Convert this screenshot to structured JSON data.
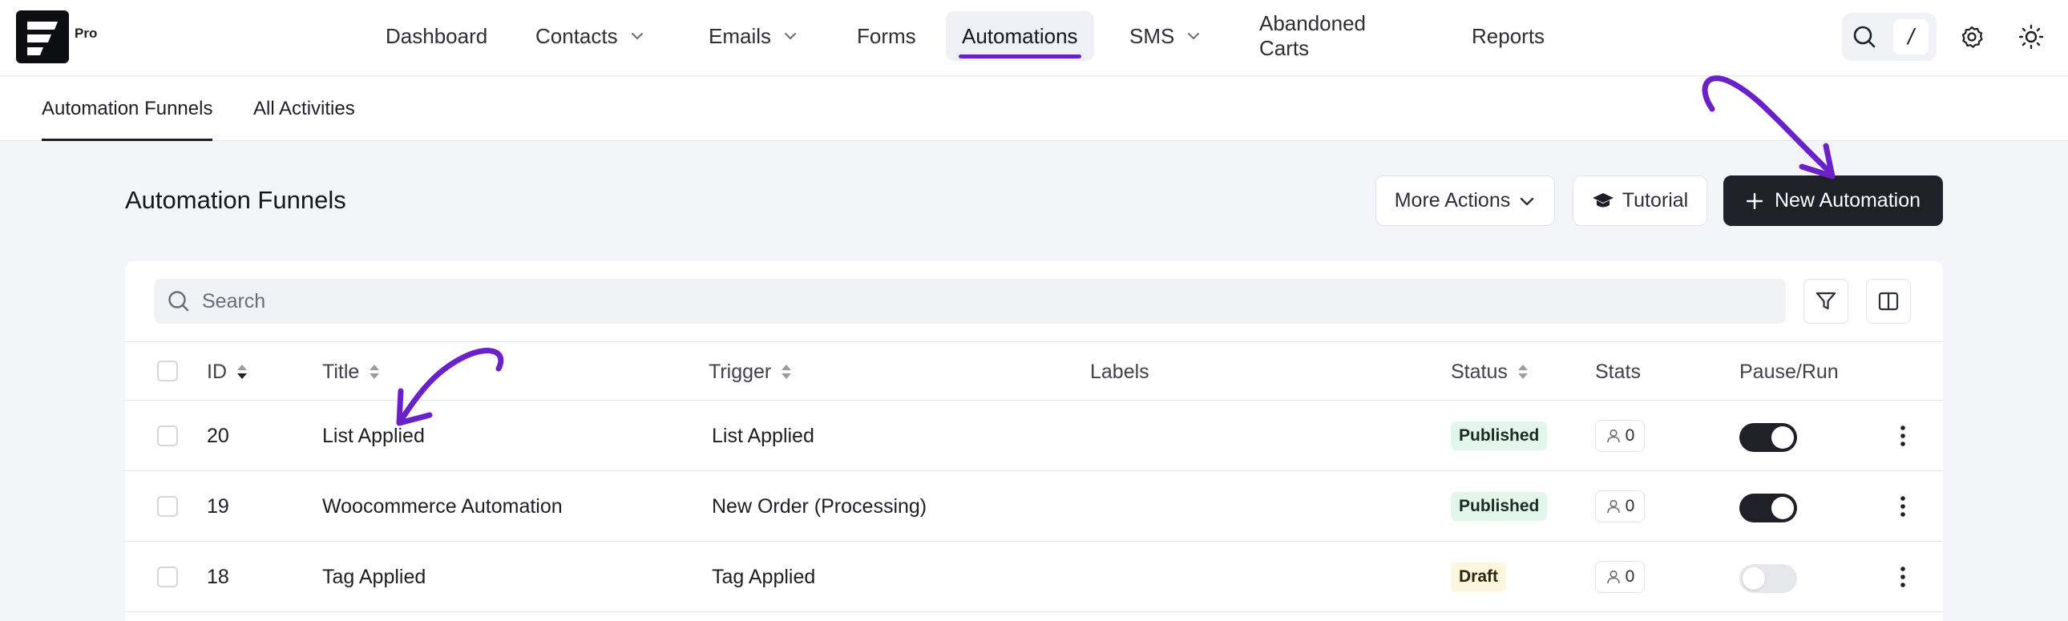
{
  "brand": {
    "badge": "Pro"
  },
  "nav": {
    "items": [
      {
        "label": "Dashboard"
      },
      {
        "label": "Contacts"
      },
      {
        "label": "Emails"
      },
      {
        "label": "Forms"
      },
      {
        "label": "Automations"
      },
      {
        "label": "SMS"
      },
      {
        "label": "Abandoned Carts"
      },
      {
        "label": "Reports"
      }
    ],
    "active": "Automations",
    "search_shortcut": "/"
  },
  "subtabs": [
    {
      "label": "Automation Funnels"
    },
    {
      "label": "All Activities"
    }
  ],
  "page": {
    "title": "Automation Funnels",
    "more_actions_label": "More Actions",
    "tutorial_label": "Tutorial",
    "new_automation_label": "New Automation"
  },
  "search": {
    "placeholder": "Search"
  },
  "table": {
    "columns": [
      {
        "label": "ID"
      },
      {
        "label": "Title"
      },
      {
        "label": "Trigger"
      },
      {
        "label": "Labels"
      },
      {
        "label": "Status"
      },
      {
        "label": "Stats"
      },
      {
        "label": "Pause/Run"
      }
    ],
    "rows": [
      {
        "id": "20",
        "title": "List Applied",
        "trigger": "List Applied",
        "status": "Published",
        "stats": "0",
        "running": true
      },
      {
        "id": "19",
        "title": "Woocommerce Automation",
        "trigger": "New Order (Processing)",
        "status": "Published",
        "stats": "0",
        "running": true
      },
      {
        "id": "18",
        "title": "Tag Applied",
        "trigger": "Tag Applied",
        "status": "Draft",
        "stats": "0",
        "running": false
      }
    ]
  },
  "colors": {
    "accent": "#6b21c8",
    "dark": "#1f2028",
    "published_bg": "#e3f6ec",
    "draft_bg": "#fdf6de"
  },
  "icons": [
    "logo-icon",
    "chevron-down-icon",
    "search-icon",
    "gear-icon",
    "sun-icon",
    "graduation-cap-icon",
    "plus-icon",
    "filter-icon",
    "columns-icon",
    "sort-icon",
    "user-icon",
    "more-vertical-icon",
    "arrow-annotation-icon"
  ]
}
